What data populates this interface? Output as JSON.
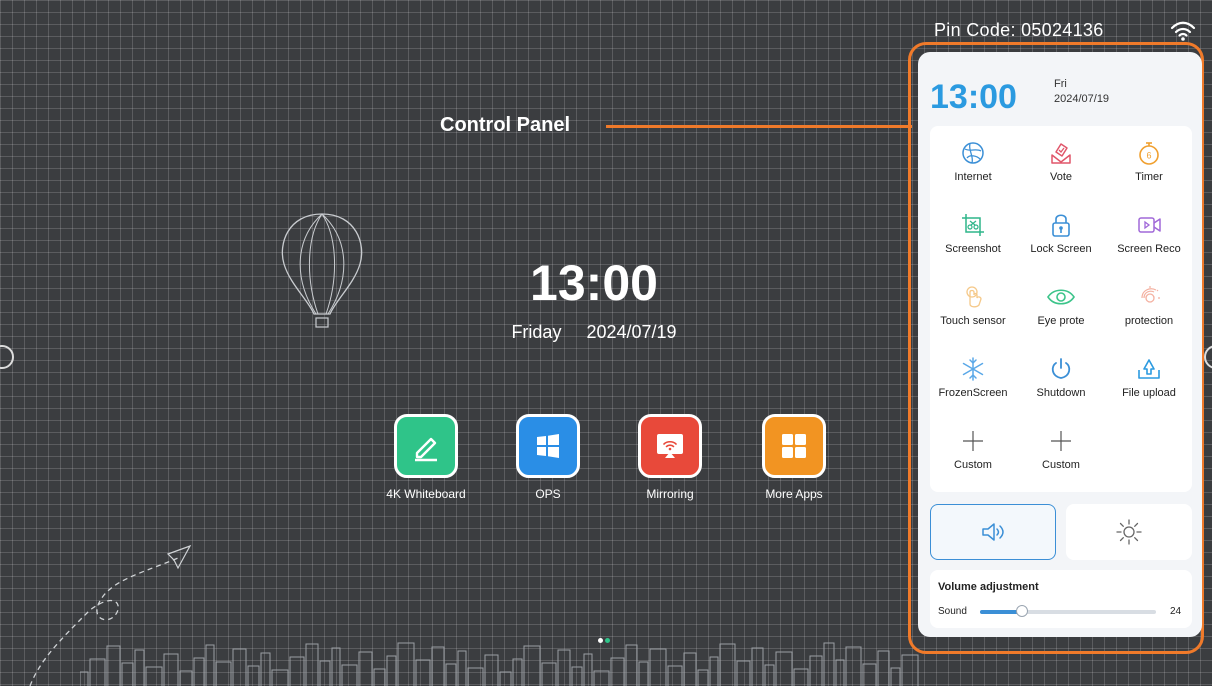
{
  "topbar": {
    "pin_label": "Pin Code:",
    "pin_code": "05024136",
    "wifi_icon": "wifi-icon"
  },
  "callout": {
    "label": "Control Panel",
    "accent": "#f07a2a"
  },
  "clock": {
    "time": "13:00",
    "weekday": "Friday",
    "date": "2024/07/19"
  },
  "apps": [
    {
      "label": "4K Whiteboard",
      "icon": "pencil-icon",
      "color": "#2fc489"
    },
    {
      "label": "OPS",
      "icon": "windows-icon",
      "color": "#2a8ee6"
    },
    {
      "label": "Mirroring",
      "icon": "mirroring-icon",
      "color": "#e8493a"
    },
    {
      "label": "More Apps",
      "icon": "grid-icon",
      "color": "#f29422"
    }
  ],
  "pager": {
    "pages": 2,
    "active": 2
  },
  "panel": {
    "time": "13:00",
    "weekday": "Fri",
    "date": "2024/07/19",
    "accent": "#2b9ae0",
    "quick_items": [
      {
        "label": "Internet",
        "icon": "globe-icon"
      },
      {
        "label": "Vote",
        "icon": "vote-icon"
      },
      {
        "label": "Timer",
        "icon": "stopwatch-icon"
      },
      {
        "label": "Screenshot",
        "icon": "scissors-icon"
      },
      {
        "label": "Lock Screen",
        "icon": "lock-icon"
      },
      {
        "label": "Screen Reco",
        "icon": "video-icon"
      },
      {
        "label": "Touch sensor",
        "icon": "touch-icon"
      },
      {
        "label": "Eye prote",
        "icon": "eye-icon"
      },
      {
        "label": "protection",
        "icon": "light-sensor-icon"
      },
      {
        "label": "FrozenScreen",
        "icon": "snowflake-icon"
      },
      {
        "label": "Shutdown",
        "icon": "power-icon"
      },
      {
        "label": "File upload",
        "icon": "upload-icon"
      },
      {
        "label": "Custom",
        "icon": "plus-icon"
      },
      {
        "label": "Custom",
        "icon": "plus-icon"
      }
    ],
    "volume_button_icon": "speaker-icon",
    "brightness_button_icon": "sun-icon",
    "volume": {
      "title": "Volume adjustment",
      "sound_label": "Sound",
      "value": "24",
      "level": 0.24
    }
  }
}
